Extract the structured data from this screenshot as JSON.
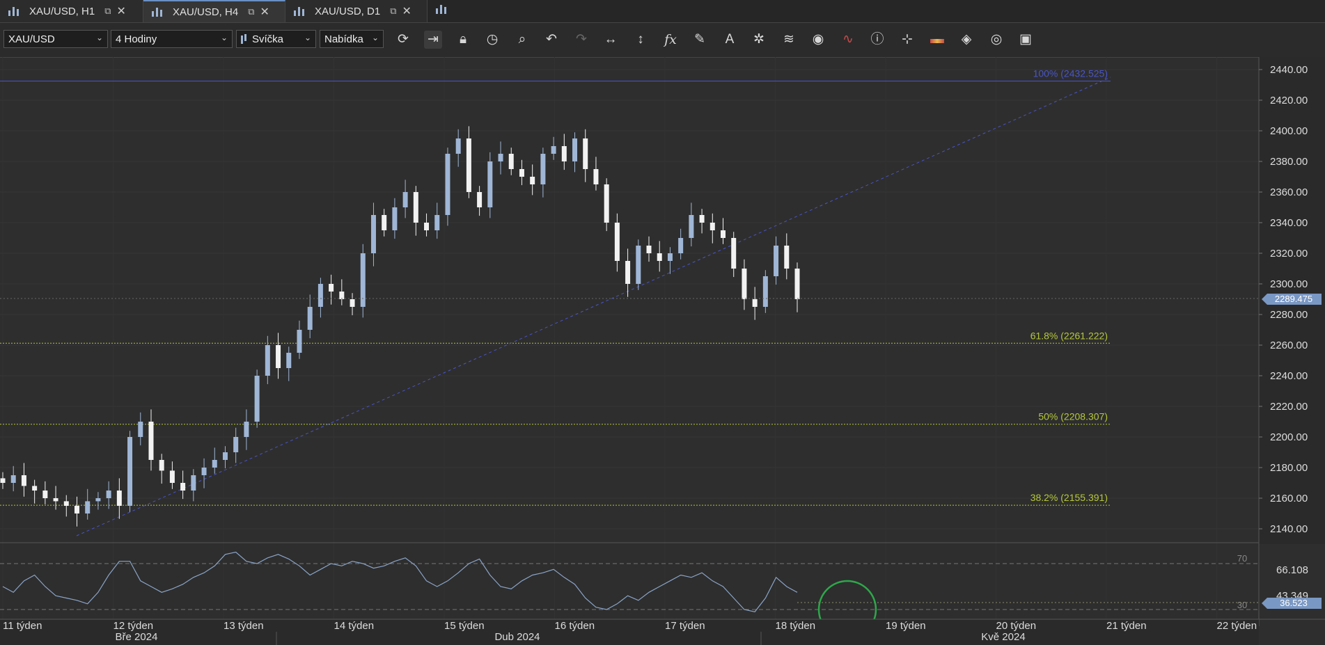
{
  "tabs": [
    {
      "label": "XAU/USD, H1",
      "active": false
    },
    {
      "label": "XAU/USD, H4",
      "active": true
    },
    {
      "label": "XAU/USD, D1",
      "active": false
    }
  ],
  "toolbar": {
    "symbol": "XAU/USD",
    "timeframe": "4 Hodiny",
    "chart_type": "Svíčka",
    "price_type": "Nabídka",
    "tools": [
      "refresh-icon",
      "shift-chart-icon",
      "lock-icon",
      "time-zoom-icon",
      "zoom-icon",
      "undo-icon",
      "redo-icon",
      "horizontal-fit-icon",
      "vertical-fit-icon",
      "indicators-fx-icon",
      "pencil-icon",
      "text-icon",
      "pattern-icon",
      "layers-icon",
      "eye-icon",
      "signals-icon",
      "info-icon",
      "crosshair-icon",
      "color-strip-icon",
      "theme-icon",
      "template-icon",
      "save-icon"
    ]
  },
  "colors": {
    "background": "#2e2e2e",
    "bull": "#9fb6d6",
    "bear": "#f2f2f2",
    "fib_100": "#4a55c8",
    "fib_green": "#b6c83a",
    "rsi": "#8aa4c8",
    "highlight_circle": "#2da84a"
  },
  "price_axis": {
    "ticks": [
      "2440.00",
      "2420.00",
      "2400.00",
      "2380.00",
      "2360.00",
      "2340.00",
      "2320.00",
      "2300.00",
      "2280.00",
      "2260.00",
      "2240.00",
      "2220.00",
      "2200.00",
      "2180.00",
      "2160.00",
      "2140.00"
    ],
    "current_price": "2289.475"
  },
  "fibonacci": [
    {
      "label": "100% (2432.525)",
      "price": 2432.525
    },
    {
      "label": "61.8% (2261.222)",
      "price": 2261.222
    },
    {
      "label": "50% (2208.307)",
      "price": 2208.307
    },
    {
      "label": "38.2% (2155.391)",
      "price": 2155.391
    }
  ],
  "rsi": {
    "levels": [
      "70",
      "30"
    ],
    "values": [
      "66.108",
      "43.349",
      "36.523"
    ]
  },
  "time_axis": {
    "weeks": [
      "11 týden",
      "12 týden",
      "13 týden",
      "14 týden",
      "15 týden",
      "16 týden",
      "17 týden",
      "18 týden",
      "19 týden",
      "20 týden",
      "21 týden",
      "22 týden"
    ],
    "months": [
      "Bře 2024",
      "Dub 2024",
      "Kvě 2024"
    ]
  },
  "chart_data": {
    "type": "candlestick",
    "symbol": "XAU/USD",
    "timeframe": "4 Hodiny",
    "ylim": [
      2130,
      2450
    ],
    "x": [
      "11 týden",
      "12 týden",
      "13 týden",
      "14 týden",
      "15 týden",
      "16 týden",
      "17 týden",
      "18 týden"
    ],
    "approx_close_path": [
      2170,
      2175,
      2168,
      2165,
      2160,
      2158,
      2155,
      2150,
      2158,
      2160,
      2165,
      2155,
      2200,
      2210,
      2185,
      2178,
      2170,
      2165,
      2175,
      2180,
      2185,
      2190,
      2200,
      2210,
      2240,
      2260,
      2245,
      2255,
      2270,
      2285,
      2300,
      2295,
      2290,
      2285,
      2320,
      2345,
      2335,
      2350,
      2360,
      2340,
      2335,
      2345,
      2385,
      2395,
      2360,
      2350,
      2380,
      2385,
      2375,
      2370,
      2365,
      2385,
      2390,
      2380,
      2395,
      2375,
      2365,
      2340,
      2315,
      2300,
      2325,
      2320,
      2315,
      2320,
      2330,
      2345,
      2340,
      2335,
      2330,
      2310,
      2290,
      2285,
      2305,
      2325,
      2310,
      2290
    ],
    "rsi_levels": [
      30,
      70
    ]
  }
}
